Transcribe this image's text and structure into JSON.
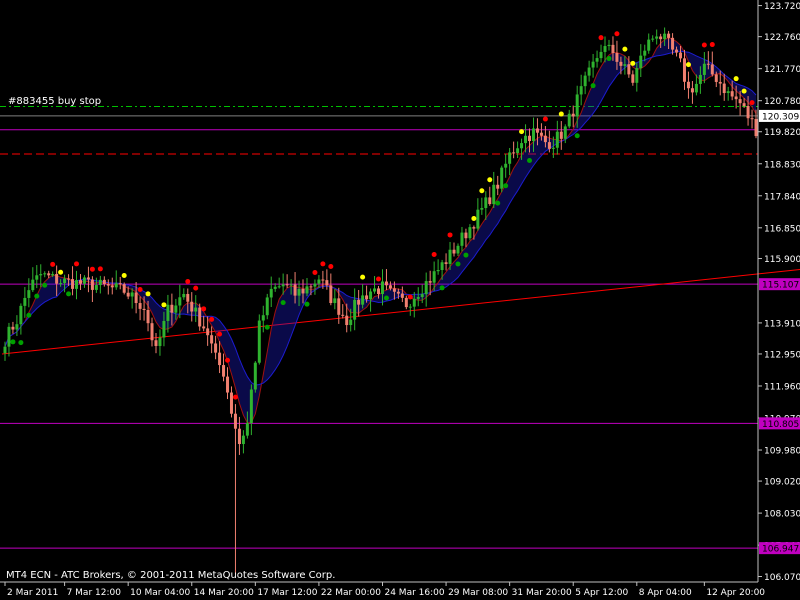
{
  "colors": {
    "background": "#000000",
    "axis": "#c0c0c0",
    "text": "#ffffff",
    "bull_candle": "#2fb32f",
    "bear_candle": "#f08070",
    "sar_top_red": "#ff0000",
    "sar_top_yellow": "#ffff00",
    "sar_bottom_green": "#00a000",
    "hline_magenta": "#c000c0",
    "trendline": "#ff0000",
    "buystop_line": "#00c000",
    "ma_blue": "#1c1cd0",
    "ma_red": "#a01010",
    "current_price_bg": "#ffffff",
    "current_price_text": "#000000",
    "level_label_bg": "#c000c0"
  },
  "chart_data": {
    "type": "candlestick",
    "title": "",
    "footer": "MT4 ECN - ATC Brokers, © 2001-2011 MetaQuotes Software Corp.",
    "order_label": "#883455 buy stop",
    "y_ticks": [
      "123.720",
      "122.760",
      "121.770",
      "120.780",
      "119.820",
      "118.830",
      "117.840",
      "116.850",
      "115.900",
      "113.910",
      "112.950",
      "111.960",
      "110.970",
      "109.980",
      "109.020",
      "108.030",
      "107.040",
      "106.070"
    ],
    "y_tick_values": [
      123.72,
      122.76,
      121.77,
      120.78,
      119.82,
      118.83,
      117.84,
      116.85,
      115.9,
      113.91,
      112.95,
      111.96,
      110.97,
      109.98,
      109.02,
      108.03,
      107.04,
      106.07
    ],
    "ylim": [
      105.9,
      123.8
    ],
    "x_ticks": [
      "2 Mar 2011",
      "7 Mar 12:00",
      "10 Mar 04:00",
      "14 Mar 20:00",
      "17 Mar 12:00",
      "22 Mar 00:00",
      "24 Mar 16:00",
      "29 Mar 08:00",
      "31 Mar 20:00",
      "5 Apr 12:00",
      "8 Apr 04:00",
      "12 Apr 20:00"
    ],
    "x_tick_index": [
      0,
      15,
      31,
      47,
      63,
      79,
      95,
      111,
      127,
      143,
      159,
      176
    ],
    "current_price": {
      "label": "120.309",
      "value": 120.309
    },
    "horizontal_levels": [
      {
        "label": "119.820",
        "value": 119.88,
        "style": "solid",
        "label_highlight": false
      },
      {
        "label": "115.107",
        "value": 115.107,
        "style": "solid",
        "label_highlight": true
      },
      {
        "label": "110.805",
        "value": 110.805,
        "style": "solid",
        "label_highlight": true
      },
      {
        "label": "106.947",
        "value": 106.947,
        "style": "solid",
        "label_highlight": true
      }
    ],
    "buy_stop_level": 120.6,
    "red_dash_level": 119.13,
    "trendline": {
      "from": [
        0,
        112.95
      ],
      "to": [
        189,
        115.5
      ]
    },
    "anchors": [
      [
        0,
        113.4
      ],
      [
        3,
        114.0
      ],
      [
        6,
        115.0
      ],
      [
        9,
        115.4
      ],
      [
        14,
        115.2
      ],
      [
        22,
        115.1
      ],
      [
        30,
        114.9
      ],
      [
        35,
        114.4
      ],
      [
        38,
        113.0
      ],
      [
        41,
        114.3
      ],
      [
        45,
        114.8
      ],
      [
        48,
        114.2
      ],
      [
        51,
        113.6
      ],
      [
        53,
        112.8
      ],
      [
        55,
        112.4
      ],
      [
        57,
        111.2
      ],
      [
        59,
        110.2
      ],
      [
        61,
        110.8
      ],
      [
        64,
        113.8
      ],
      [
        67,
        114.9
      ],
      [
        70,
        115.1
      ],
      [
        73,
        114.8
      ],
      [
        76,
        115.0
      ],
      [
        79,
        115.3
      ],
      [
        82,
        114.7
      ],
      [
        86,
        114.0
      ],
      [
        89,
        114.6
      ],
      [
        92,
        114.9
      ],
      [
        95,
        115.0
      ],
      [
        98,
        114.7
      ],
      [
        101,
        114.5
      ],
      [
        104,
        114.9
      ],
      [
        108,
        115.4
      ],
      [
        112,
        116.0
      ],
      [
        116,
        116.7
      ],
      [
        120,
        117.4
      ],
      [
        124,
        118.2
      ],
      [
        127,
        119.1
      ],
      [
        130,
        119.6
      ],
      [
        133,
        119.8
      ],
      [
        136,
        119.5
      ],
      [
        138,
        119.5
      ],
      [
        141,
        119.9
      ],
      [
        144,
        120.8
      ],
      [
        147,
        121.6
      ],
      [
        150,
        122.4
      ],
      [
        153,
        122.3
      ],
      [
        155,
        121.9
      ],
      [
        158,
        121.4
      ],
      [
        161,
        122.4
      ],
      [
        164,
        122.9
      ],
      [
        167,
        122.5
      ],
      [
        170,
        121.9
      ],
      [
        172,
        121.1
      ],
      [
        174,
        121.3
      ],
      [
        176,
        121.8
      ],
      [
        179,
        121.5
      ],
      [
        182,
        121.0
      ],
      [
        185,
        120.7
      ],
      [
        187,
        120.3
      ],
      [
        189,
        119.9
      ]
    ],
    "spikes": [
      {
        "i": 58,
        "low": 106.15,
        "high": 111.4
      }
    ]
  }
}
